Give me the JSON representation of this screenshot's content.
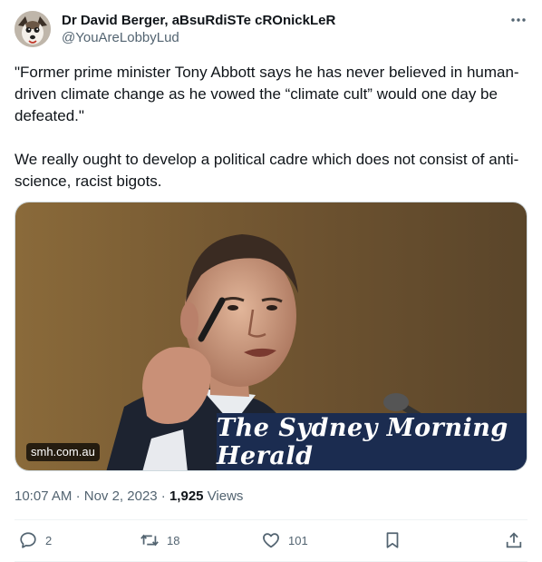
{
  "author": {
    "display_name": "Dr David Berger, aBsuRdiSTe cROnickLeR",
    "handle": "@YouAreLobbyLud",
    "avatar_icon": "dog-avatar-icon"
  },
  "tweet": {
    "paragraphs": [
      "\"Former prime minister Tony Abbott says he has never believed in human-driven climate change as he vowed the “climate cult” would one day be defeated.\"",
      "We really ought to develop a political cadre which does not consist of anti-science, racist bigots."
    ]
  },
  "media": {
    "domain": "smh.com.au",
    "masthead": "The Sydney Morning Herald",
    "brand_color": "#1b2c50"
  },
  "meta": {
    "time": "10:07 AM",
    "separator": "·",
    "date": "Nov 2, 2023",
    "views_count": "1,925",
    "views_label": "Views"
  },
  "actions": {
    "replies": "2",
    "reposts": "18",
    "likes": "101"
  },
  "colors": {
    "text_primary": "#0f1419",
    "text_secondary": "#536471",
    "border": "#cfd9de"
  }
}
